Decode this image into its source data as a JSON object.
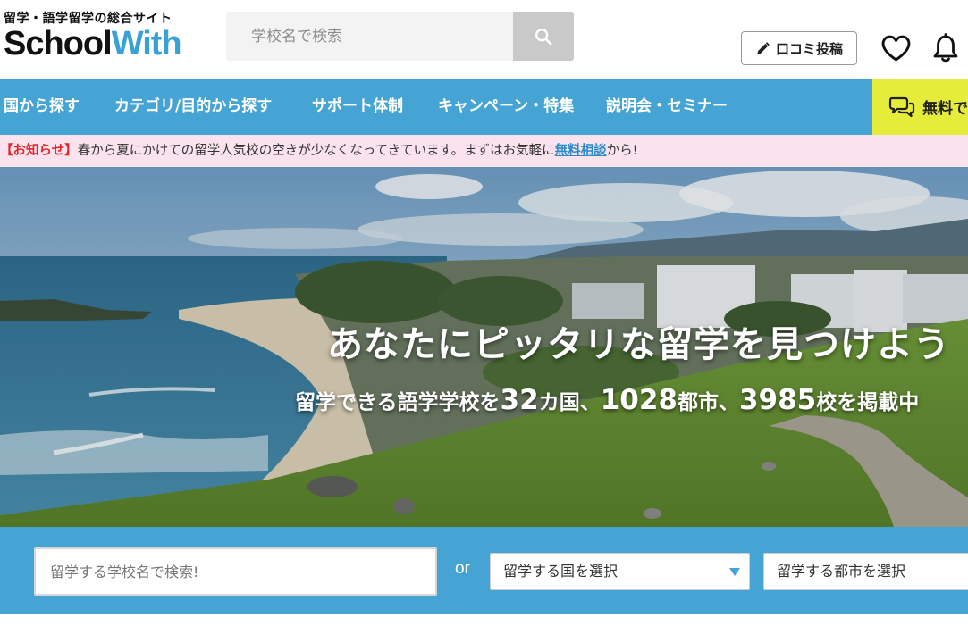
{
  "header": {
    "tagline": "留学・語学留学の総合サイト",
    "logo_school": "School",
    "logo_with": "With",
    "search_placeholder": "学校名で検索",
    "review_button": "口コミ投稿"
  },
  "nav": {
    "items": [
      {
        "label": "国から探す"
      },
      {
        "label": "カテゴリ/目的から探す"
      },
      {
        "label": "サポート体制"
      },
      {
        "label": "キャンペーン・特集"
      },
      {
        "label": "説明会・セミナー"
      }
    ],
    "consult_label": "無料で"
  },
  "notice": {
    "label": "【お知らせ】",
    "text": "春から夏にかけての留学人気校の空きが少なくなってきています。まずはお気軽に",
    "link": "無料相談",
    "suffix": "から!"
  },
  "hero": {
    "title": "あなたにピッタリな留学を見つけよう",
    "sub_prefix": "留学できる語学学校を",
    "countries": "32",
    "countries_unit": "カ国、",
    "cities": "1028",
    "cities_unit": "都市、",
    "schools": "3985",
    "schools_unit": "校を掲載中"
  },
  "search": {
    "school_placeholder": "留学する学校名で検索!",
    "or": "or",
    "country_select": "留学する国を選択",
    "city_select": "留学する都市を選択"
  },
  "colors": {
    "brand_blue": "#45a4d4",
    "logo_blue": "#3aa0d8",
    "consult_yellow": "#e5ed3a",
    "notice_bg": "#fbe3ee",
    "notice_red": "#e2252b"
  },
  "icons": {
    "search": "search-icon",
    "pencil": "pencil-icon",
    "heart": "heart-icon",
    "bell": "bell-icon",
    "chat": "chat-icon",
    "caret": "caret-down-icon"
  }
}
